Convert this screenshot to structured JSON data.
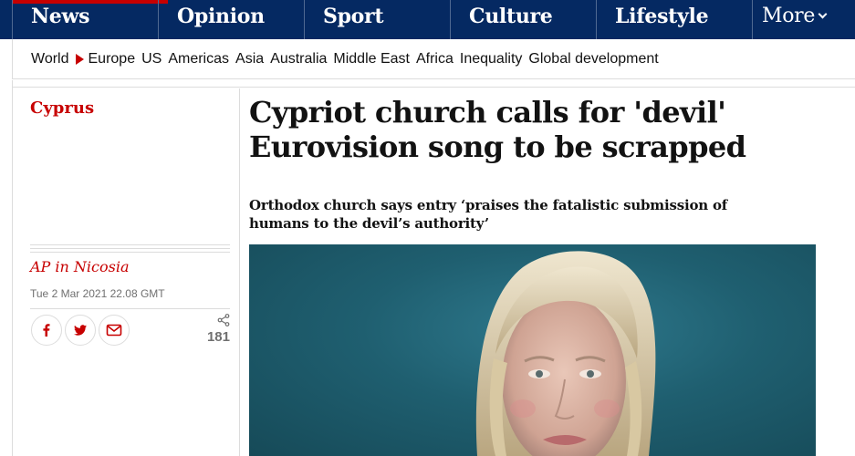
{
  "nav": {
    "pillars": [
      {
        "label": "News"
      },
      {
        "label": "Opinion"
      },
      {
        "label": "Sport"
      },
      {
        "label": "Culture"
      },
      {
        "label": "Lifestyle"
      },
      {
        "label": "More"
      }
    ],
    "subnav": [
      "World",
      "Europe",
      "US",
      "Americas",
      "Asia",
      "Australia",
      "Middle East",
      "Africa",
      "Inequality",
      "Global development"
    ]
  },
  "article": {
    "section": "Cyprus",
    "headline_line1": "Cypriot church calls for 'devil'",
    "headline_line2": "Eurovision song to be scrapped",
    "standfirst_line1": "Orthodox church says entry ‘praises the fatalistic submission of",
    "standfirst_line2": "humans to the devil’s authority’",
    "byline": "AP in Nicosia",
    "date": "Tue 2 Mar 2021 22.08 GMT",
    "share_count": "181"
  },
  "icons": {
    "facebook": "facebook-icon",
    "twitter": "twitter-icon",
    "email": "email-icon",
    "share": "share-icon",
    "breadcrumb_arrow": "triangle-right-icon"
  },
  "colors": {
    "nav_bg": "#052962",
    "news_red": "#c70000",
    "text": "#121212",
    "muted": "#707070"
  }
}
